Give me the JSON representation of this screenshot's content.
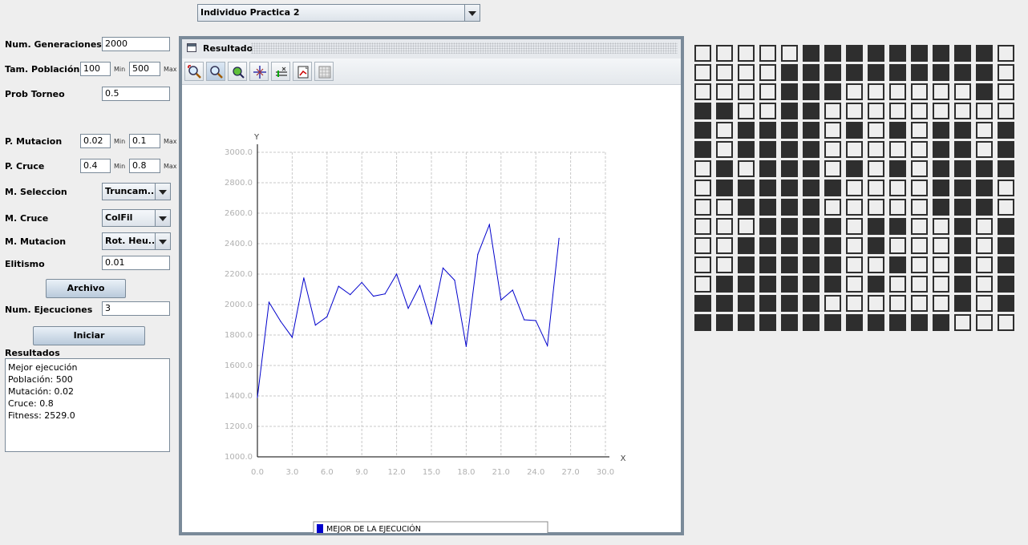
{
  "top_combo": {
    "value": "Individuo Practica 2"
  },
  "form": {
    "num_generaciones": {
      "label": "Num. Generaciones",
      "value": "2000"
    },
    "tam_poblacion": {
      "label": "Tam. Población",
      "value": "100",
      "min_label": "Min",
      "max_value": "500",
      "max_label": "Max"
    },
    "prob_torneo": {
      "label": "Prob Torneo",
      "value": "0.5"
    },
    "p_mutacion": {
      "label": "P. Mutacion",
      "value": "0.02",
      "min_label": "Min",
      "max_value": "0.1",
      "max_label": "Max"
    },
    "p_cruce": {
      "label": "P. Cruce",
      "value": "0.4",
      "min_label": "Min",
      "max_value": "0.8",
      "max_label": "Max"
    },
    "m_seleccion": {
      "label": "M. Seleccion",
      "value": "Truncam..."
    },
    "m_cruce": {
      "label": "M. Cruce",
      "value": "ColFil"
    },
    "m_mutacion": {
      "label": "M. Mutacion",
      "value": "Rot. Heu..."
    },
    "elitismo": {
      "label": "Elitismo",
      "value": "0.01"
    },
    "archivo_button": "Archivo",
    "num_ejecuciones": {
      "label": "Num. Ejecuciones",
      "value": "3"
    },
    "iniciar_button": "Iniciar"
  },
  "results": {
    "heading": "Resultados",
    "lines": [
      "Mejor ejecución",
      "Población: 500",
      "Mutación: 0.02",
      "Cruce: 0.8",
      "Fitness: 2529.0"
    ]
  },
  "chart_window": {
    "title": "Resultado",
    "toolbar_icons": [
      "zoom-in-icon",
      "zoom-icon",
      "move-icon",
      "center-icon",
      "axis-scale-icon",
      "export-icon",
      "grid-toggle-icon"
    ]
  },
  "chart_data": {
    "type": "line",
    "xlabel": "X",
    "ylabel": "Y",
    "xlim": [
      0,
      30
    ],
    "ylim": [
      1000,
      3000
    ],
    "x_ticks": [
      "0.0",
      "3.0",
      "6.0",
      "9.0",
      "12.0",
      "15.0",
      "18.0",
      "21.0",
      "24.0",
      "27.0",
      "30.0"
    ],
    "y_ticks": [
      "1000.0",
      "1200.0",
      "1400.0",
      "1600.0",
      "1800.0",
      "2000.0",
      "2200.0",
      "2400.0",
      "2600.0",
      "2800.0",
      "3000.0"
    ],
    "grid": true,
    "legend_position": "bottom",
    "series": [
      {
        "name": "MEJOR DE LA EJECUCIÓN",
        "color": "#0000cc",
        "x": [
          0,
          1,
          2,
          3,
          4,
          5,
          6,
          7,
          8,
          9,
          10,
          11,
          12,
          13,
          14,
          15,
          16,
          17,
          18,
          19,
          20,
          21,
          22,
          23,
          24,
          25,
          26
        ],
        "y": [
          1390,
          2015,
          1890,
          1785,
          2175,
          1865,
          1920,
          2120,
          2065,
          2145,
          2055,
          2070,
          2200,
          1975,
          2125,
          1870,
          2240,
          2160,
          1725,
          2330,
          2525,
          2030,
          2095,
          1900,
          1895,
          1730,
          2435
        ]
      }
    ]
  },
  "board": {
    "rows": [
      "wwwwwbbbbbbbbbw",
      "wwwwbbbbbbbbbbw",
      "wwwwbbbwwwwwwbw",
      "bbwwbbwwwwwwwww",
      "bwbbbbwbwbwbbwb",
      "bwbbbbwwwwwbbwb",
      "wbwbbbwbwbwbbbb",
      "wbbbbbbwwwwbbbw",
      "wwbbbbwwwwwbbbw",
      "wwwbbbbwbbwwbwb",
      "wwbbbbbwbwwwbwb",
      "wwbbbbbwwbwwbwb",
      "wbbbbbbwbwwwbwb",
      "bbbbbbwwwwwwbwb",
      "bbbbbbbbbbbbwww"
    ]
  }
}
